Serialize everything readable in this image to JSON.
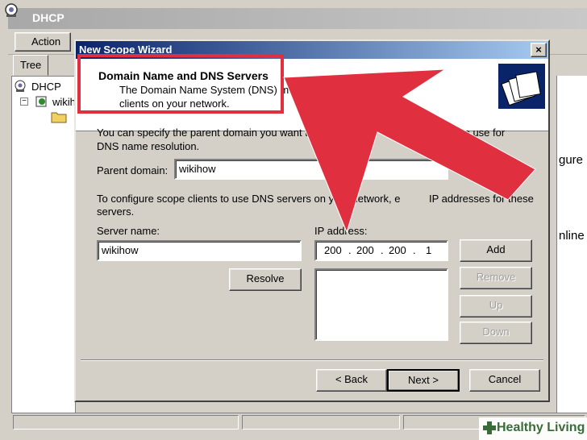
{
  "background_window": {
    "title": "DHCP",
    "menu": {
      "action_label": "Action"
    },
    "tree_tab_label": "Tree",
    "tree_items": [
      "DHCP",
      "wikih"
    ],
    "right_fragments": [
      "gure",
      "nline"
    ]
  },
  "wizard": {
    "title": "New Scope Wizard",
    "close_glyph": "×",
    "header": {
      "title": "Domain Name and DNS Servers",
      "subtitle_line1": "The Domain Name System (DNS) maps",
      "subtitle_line2": "clients on your network."
    },
    "intro_text_line1": "You can specify the parent domain you want the client",
    "intro_text_line1_end": "to use for",
    "intro_text_line2": "DNS name resolution.",
    "parent_domain": {
      "label": "Parent domain:",
      "value": "wikihow"
    },
    "dns_text_line1": "To configure scope clients to use DNS servers on your network, e",
    "dns_text_line1_end": "IP addresses for these",
    "dns_text_line2": "servers.",
    "server_name": {
      "label": "Server name:",
      "value": "wikihow"
    },
    "ip_address": {
      "label": "IP address:",
      "octets": [
        "200",
        "200",
        "200",
        "1"
      ],
      "dot": "."
    },
    "buttons": {
      "resolve": "Resolve",
      "add": "Add",
      "remove": "Remove",
      "up": "Up",
      "down": "Down",
      "back": "< Back",
      "next": "Next >",
      "cancel": "Cancel"
    }
  },
  "overlay": {
    "arrow_color": "#e03040",
    "box_color": "#e03040"
  },
  "watermark": {
    "text": "Healthy Living",
    "color": "#3a6b3a"
  }
}
